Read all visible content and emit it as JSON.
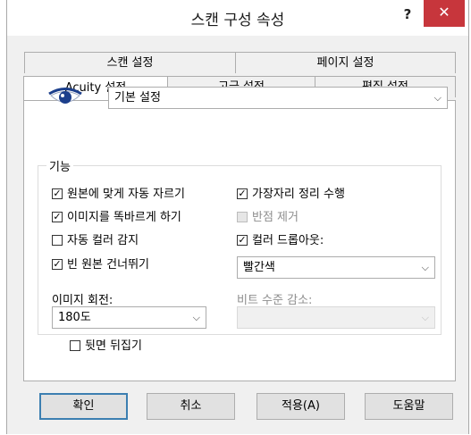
{
  "window": {
    "title": "스캔 구성 속성",
    "help": "?",
    "close": "✕"
  },
  "tabs": {
    "row1": [
      "스캔 설정",
      "페이지 설정"
    ],
    "row2": [
      "Acuity 설정",
      "고급 설정",
      "편집 설정"
    ]
  },
  "preset": {
    "value": "기본 설정"
  },
  "features": {
    "label": "기능",
    "items": [
      {
        "label": "원본에 맞게 자동 자르기",
        "checked": true,
        "enabled": true
      },
      {
        "label": "이미지를 똑바르게 하기",
        "checked": true,
        "enabled": true
      },
      {
        "label": "자동 컬러 감지",
        "checked": false,
        "enabled": true
      },
      {
        "label": "빈 원본 건너뛰기",
        "checked": true,
        "enabled": true
      },
      {
        "label": "가장자리 정리 수행",
        "checked": true,
        "enabled": true
      },
      {
        "label": "반점 제거",
        "checked": false,
        "enabled": false
      },
      {
        "label": "컬러 드롭아웃:",
        "checked": true,
        "enabled": true
      }
    ],
    "color_dropout": {
      "value": "빨간색"
    },
    "rotate": {
      "label": "이미지 회전:",
      "value": "180도"
    },
    "bit_reduce": {
      "label": "비트 수준 감소:",
      "value": ""
    },
    "flip_back": {
      "label": "뒷면 뒤집기",
      "checked": false
    }
  },
  "buttons": {
    "ok": "확인",
    "cancel": "취소",
    "apply": "적용(A)",
    "help": "도움말"
  },
  "colors": {
    "accent": "#3c7fb1",
    "close": "#c7363c",
    "eye": "#1c3f8c"
  }
}
